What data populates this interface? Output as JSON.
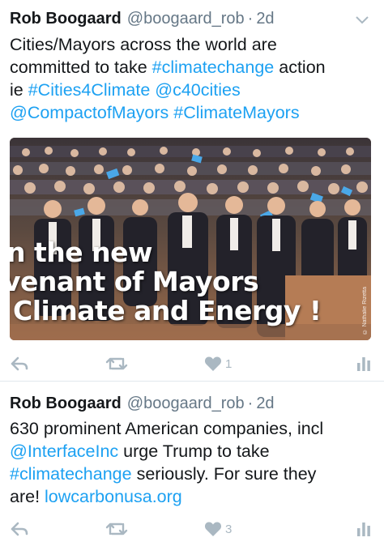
{
  "tweets": [
    {
      "author_name": "Rob Boogaard",
      "handle": "@boogaard_rob",
      "separator": "·",
      "time": "2d",
      "text_segments": [
        [
          "Cities/Mayors across the world are"
        ],
        [
          "committed to take ",
          "#climatechange",
          " action"
        ],
        [
          "ie ",
          "#Cities4Climate",
          " ",
          "@c40cities"
        ],
        [
          "@CompactofMayors",
          " ",
          "#ClimateMayors"
        ]
      ],
      "line1": "Cities/Mayors across the world are",
      "line2_a": "committed to take ",
      "line2_link": "#climatechange",
      "line2_b": " action",
      "line3_a": "ie ",
      "line3_link1": "#Cities4Climate",
      "line3_link2": "@c40cities",
      "line4_link1": "@CompactofMayors",
      "line4_link2": "#ClimateMayors",
      "media": {
        "banner_line1": "n the new",
        "banner_line2": "venant of Mayors",
        "banner_line3": "Climate and Energy !",
        "credit": "© Nathalie Rizetta"
      },
      "likes": "1"
    },
    {
      "author_name": "Rob Boogaard",
      "handle": "@boogaard_rob",
      "separator": "·",
      "time": "2d",
      "line1": "630 prominent American companies, incl",
      "line2_link": "@InterfaceInc",
      "line2_b": " urge Trump to take",
      "line3_link": "#climatechange",
      "line3_b": " seriously. For sure they",
      "line4_a": "are! ",
      "line4_link": "lowcarbonusa.org",
      "likes": "3"
    }
  ],
  "colors": {
    "link": "#1da1f2",
    "text": "#14171a",
    "secondary": "#657786",
    "action_icon": "#aab8c2",
    "divider": "#e1e8ed"
  },
  "icons": {
    "reply": "reply-icon",
    "retweet": "retweet-icon",
    "like": "heart-icon",
    "stats": "analytics-icon",
    "menu": "chevron-down-icon"
  }
}
